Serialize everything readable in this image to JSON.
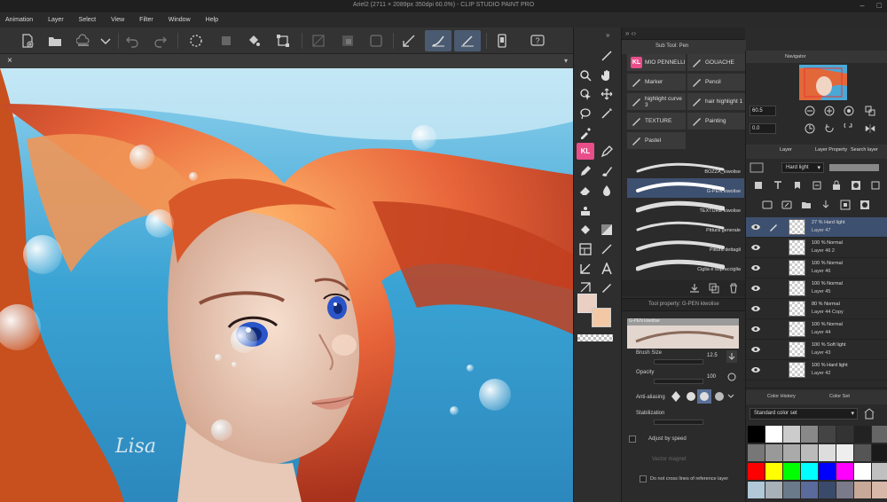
{
  "window": {
    "title": "Ariel2 (2711 × 2089px 350dpi 60.0%) - CLIP STUDIO PAINT PRO"
  },
  "menu": [
    "Animation",
    "Layer",
    "Select",
    "View",
    "Filter",
    "Window",
    "Help"
  ],
  "toolbar": {
    "icons": [
      "new-file-icon",
      "open-folder-icon",
      "save-cloud-icon",
      "dropdown-arrow-icon",
      "undo-icon",
      "redo-icon",
      "selection-loading-icon",
      "clear-icon",
      "fill-icon",
      "transform-icon",
      "deselect-icon",
      "invert-selection-icon",
      "selection-border-icon",
      "stabilizer-icon",
      "pen-pressure-icon",
      "pen-tilt-icon",
      "smartphone-icon",
      "help-icon"
    ]
  },
  "tab": {
    "close_glyph": "×",
    "arrow_glyph": "▾"
  },
  "canvas": {
    "signature": "Lisa"
  },
  "tools": {
    "kl_label": "KL",
    "collapse_glyph": "»",
    "main_color": "#e9d0c2",
    "sub_color": "#f3c9a5"
  },
  "sub_tool": {
    "panel_label": "Sub Tool: Pen",
    "arrows": "» ‹›",
    "groups": [
      {
        "label": "MIO PENNELLI",
        "kl": true
      },
      {
        "label": "GOUACHE",
        "kl": false
      },
      {
        "label": "Marker",
        "kl": false
      },
      {
        "label": "Pencil",
        "kl": false
      },
      {
        "label": "highlight curve 3",
        "kl": false
      },
      {
        "label": "hair highlight 1",
        "kl": false
      },
      {
        "label": "TEXTURE",
        "kl": false
      },
      {
        "label": "Painting",
        "kl": false
      },
      {
        "label": "Pastel",
        "kl": false
      }
    ],
    "brushes": [
      {
        "name": "BOZZA_kiwolise",
        "selected": false
      },
      {
        "name": "G-PEN kiwolise",
        "selected": true
      },
      {
        "name": "TEXTURE kiwolise",
        "selected": false
      },
      {
        "name": "Pittura generale",
        "selected": false
      },
      {
        "name": "Pittura dettagli",
        "selected": false
      },
      {
        "name": "Ciglia e sopracciglia",
        "selected": false
      }
    ]
  },
  "tool_property": {
    "panel_label": "Tool property: G-PEN kiwolise",
    "preview_label": "G-PEN kiwolise",
    "brush_size_label": "Brush Size",
    "brush_size_value": "12.5",
    "opacity_label": "Opacity",
    "opacity_value": "100",
    "anti_aliasing_label": "Anti-aliasing",
    "stabilization_label": "Stabilization",
    "adjust_speed_label": "Adjust by speed",
    "vector_magnet_label": "Vector magnet",
    "reference_label": "Do not cross lines of reference layer"
  },
  "navigator": {
    "label": "Navigator",
    "zoom_value": "60.5",
    "rotation_value": "0.0"
  },
  "layers": {
    "tabs": [
      "Layer",
      "Layer Property",
      "Search layer"
    ],
    "blend_mode": "Hard light",
    "items": [
      {
        "mode": "27 % Hard light",
        "name": "Layer 47",
        "selected": true
      },
      {
        "mode": "100 % Normal",
        "name": "Layer 46 2",
        "selected": false
      },
      {
        "mode": "100 % Normal",
        "name": "Layer 46",
        "selected": false
      },
      {
        "mode": "100 % Normal",
        "name": "Layer 45",
        "selected": false
      },
      {
        "mode": "80 % Normal",
        "name": "Layer 44 Copy",
        "selected": false
      },
      {
        "mode": "100 % Normal",
        "name": "Layer 44",
        "selected": false
      },
      {
        "mode": "100 % Soft light",
        "name": "Layer 43",
        "selected": false
      },
      {
        "mode": "100 % Hard light",
        "name": "Layer 42",
        "selected": false
      }
    ]
  },
  "color_set": {
    "tabs": [
      "Color History",
      "Color Set"
    ],
    "set_name": "Standard color set",
    "colors": [
      "#000000",
      "#ffffff",
      "#cccccc",
      "#888888",
      "#444444",
      "#333333",
      "#222222",
      "#666666",
      "#777777",
      "#999999",
      "#aaaaaa",
      "#bbbbbb",
      "#dddddd",
      "#eeeeee",
      "#555555",
      "#1a1a1a",
      "#ff0000",
      "#ffff00",
      "#00ff00",
      "#00ffff",
      "#0000ff",
      "#ff00ff",
      "#ffffff",
      "#c0c0c0",
      "#b0c8d8",
      "#a8b0b8",
      "#6a7a8a",
      "#5a6a9a",
      "#3a4a6a",
      "#7a7a8a",
      "#c8a898",
      "#d8b8a8"
    ]
  }
}
